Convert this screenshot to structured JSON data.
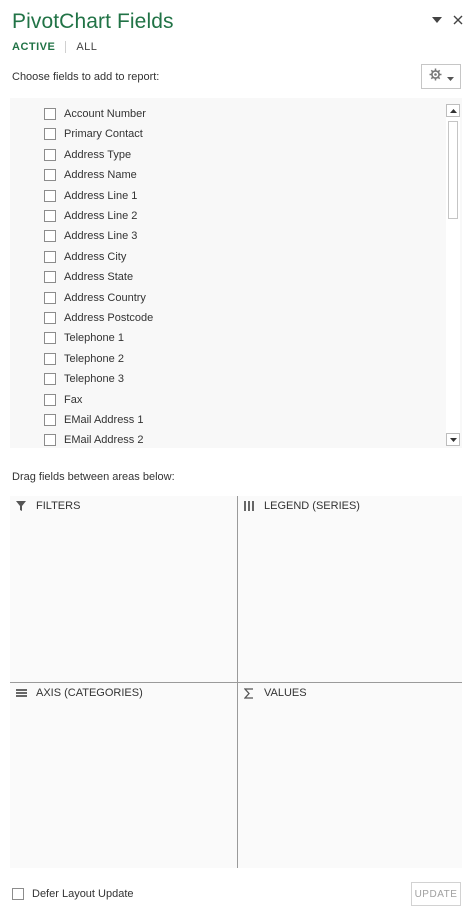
{
  "header": {
    "title": "PivotChart Fields",
    "menu_icon": "chevron-down-icon",
    "close_icon": "close-icon"
  },
  "tabs": [
    {
      "label": "ACTIVE"
    },
    {
      "label": "ALL"
    }
  ],
  "field_section": {
    "instruction": "Choose fields to add to report:",
    "settings_icon": "gear-icon"
  },
  "fields": [
    {
      "label": "Account Number",
      "checked": false
    },
    {
      "label": "Primary Contact",
      "checked": false
    },
    {
      "label": "Address Type",
      "checked": false
    },
    {
      "label": "Address Name",
      "checked": false
    },
    {
      "label": "Address Line 1",
      "checked": false
    },
    {
      "label": "Address Line 2",
      "checked": false
    },
    {
      "label": "Address Line 3",
      "checked": false
    },
    {
      "label": "Address City",
      "checked": false
    },
    {
      "label": "Address State",
      "checked": false
    },
    {
      "label": "Address Country",
      "checked": false
    },
    {
      "label": "Address Postcode",
      "checked": false
    },
    {
      "label": "Telephone 1",
      "checked": false
    },
    {
      "label": "Telephone 2",
      "checked": false
    },
    {
      "label": "Telephone 3",
      "checked": false
    },
    {
      "label": "Fax",
      "checked": false
    },
    {
      "label": "EMail Address 1",
      "checked": false
    },
    {
      "label": "EMail Address 2",
      "checked": false
    }
  ],
  "drag_section": {
    "instruction": "Drag fields between areas below:"
  },
  "areas": {
    "filters": {
      "label": "FILTERS",
      "icon": "filter-icon"
    },
    "legend": {
      "label": "LEGEND (SERIES)",
      "icon": "columns-icon"
    },
    "axis": {
      "label": "AXIS (CATEGORIES)",
      "icon": "rows-icon"
    },
    "values": {
      "label": "VALUES",
      "icon": "sigma-icon"
    }
  },
  "footer": {
    "defer_label": "Defer Layout Update",
    "defer_checked": false,
    "update_label": "UPDATE"
  },
  "colors": {
    "accent": "#217346"
  }
}
